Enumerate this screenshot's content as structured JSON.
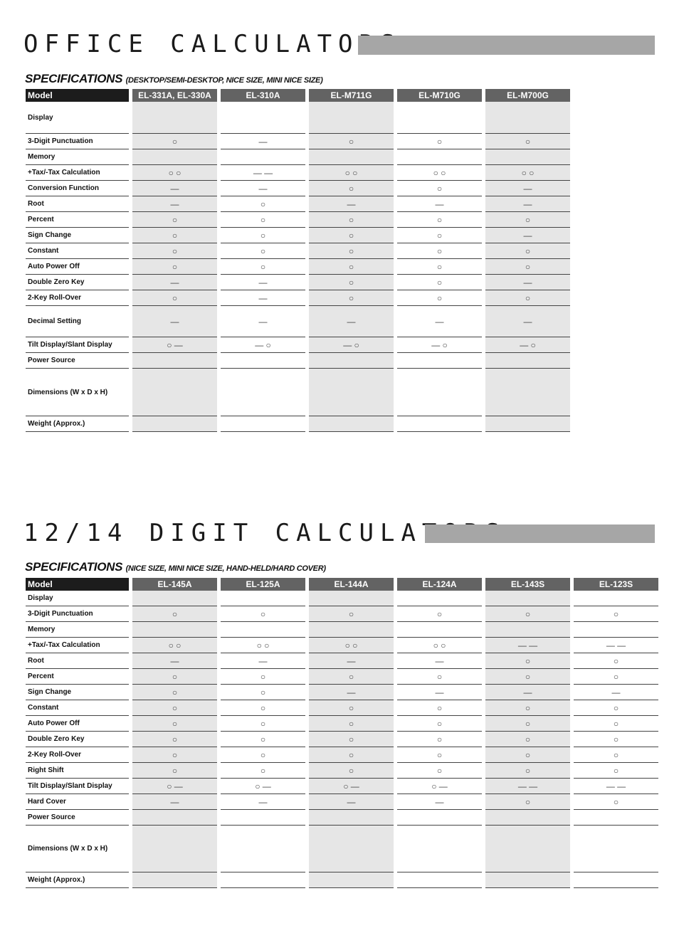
{
  "sections": [
    {
      "title": "OFFICE CALCULATORS",
      "spec": "SPECIFICATIONS",
      "spec_sub": "(DESKTOP/SEMI-DESKTOP, NICE SIZE, MINI NICE SIZE)",
      "header": "Model",
      "models": [
        "EL-331A, EL-330A",
        "EL-310A",
        "EL-M711G",
        "EL-M710G",
        "EL-M700G"
      ],
      "rows": [
        {
          "label": "Display",
          "values": [
            "",
            "",
            "",
            "",
            ""
          ]
        },
        {
          "label": "3-Digit Punctuation",
          "values": [
            "○",
            "—",
            "○",
            "○",
            "○"
          ]
        },
        {
          "label": "Memory",
          "values": [
            "",
            "",
            "",
            "",
            ""
          ]
        },
        {
          "label": "+Tax/-Tax Calculation",
          "values": [
            "○ ○",
            "— —",
            "○ ○",
            "○ ○",
            "○ ○"
          ]
        },
        {
          "label": "Conversion Function",
          "values": [
            "—",
            "—",
            "○",
            "○",
            "—"
          ]
        },
        {
          "label": "Root",
          "values": [
            "—",
            "○",
            "—",
            "—",
            "—"
          ]
        },
        {
          "label": "Percent",
          "values": [
            "○",
            "○",
            "○",
            "○",
            "○"
          ]
        },
        {
          "label": "Sign Change",
          "values": [
            "○",
            "○",
            "○",
            "○",
            "—"
          ]
        },
        {
          "label": "Constant",
          "values": [
            "○",
            "○",
            "○",
            "○",
            "○"
          ]
        },
        {
          "label": "Auto Power Off",
          "values": [
            "○",
            "○",
            "○",
            "○",
            "○"
          ]
        },
        {
          "label": "Double Zero Key",
          "values": [
            "—",
            "—",
            "○",
            "○",
            "—"
          ]
        },
        {
          "label": "2-Key Roll-Over",
          "values": [
            "○",
            "—",
            "○",
            "○",
            "○"
          ]
        },
        {
          "label": "Decimal Setting",
          "values": [
            "—",
            "—",
            "—",
            "—",
            "—"
          ]
        },
        {
          "label": "Tilt Display/Slant Display",
          "values": [
            "○ —",
            "— ○",
            "— ○",
            "— ○",
            "— ○"
          ]
        },
        {
          "label": "Power Source",
          "values": [
            "",
            "",
            "",
            "",
            ""
          ]
        },
        {
          "label": "Dimensions (W x D x H)",
          "values": [
            "",
            "",
            "",
            "",
            ""
          ]
        },
        {
          "label": "Weight (Approx.)",
          "values": [
            "",
            "",
            "",
            "",
            ""
          ]
        }
      ]
    },
    {
      "title": "12/14 DIGIT CALCULATORS",
      "spec": "SPECIFICATIONS",
      "spec_sub": "(NICE SIZE, MINI NICE SIZE, HAND-HELD/HARD COVER)",
      "header": "Model",
      "models": [
        "EL-145A",
        "EL-125A",
        "EL-144A",
        "EL-124A",
        "EL-143S",
        "EL-123S"
      ],
      "rows": [
        {
          "label": "Display",
          "values": [
            "",
            "",
            "",
            "",
            "",
            ""
          ]
        },
        {
          "label": "3-Digit Punctuation",
          "values": [
            "○",
            "○",
            "○",
            "○",
            "○",
            "○"
          ]
        },
        {
          "label": "Memory",
          "values": [
            "",
            "",
            "",
            "",
            "",
            ""
          ]
        },
        {
          "label": "+Tax/-Tax Calculation",
          "values": [
            "○ ○",
            "○ ○",
            "○ ○",
            "○ ○",
            "— —",
            "— —"
          ]
        },
        {
          "label": "Root",
          "values": [
            "—",
            "—",
            "—",
            "—",
            "○",
            "○"
          ]
        },
        {
          "label": "Percent",
          "values": [
            "○",
            "○",
            "○",
            "○",
            "○",
            "○"
          ]
        },
        {
          "label": "Sign Change",
          "values": [
            "○",
            "○",
            "—",
            "—",
            "—",
            "—"
          ]
        },
        {
          "label": "Constant",
          "values": [
            "○",
            "○",
            "○",
            "○",
            "○",
            "○"
          ]
        },
        {
          "label": "Auto Power Off",
          "values": [
            "○",
            "○",
            "○",
            "○",
            "○",
            "○"
          ]
        },
        {
          "label": "Double Zero Key",
          "values": [
            "○",
            "○",
            "○",
            "○",
            "○",
            "○"
          ]
        },
        {
          "label": "2-Key Roll-Over",
          "values": [
            "○",
            "○",
            "○",
            "○",
            "○",
            "○"
          ]
        },
        {
          "label": "Right Shift",
          "values": [
            "○",
            "○",
            "○",
            "○",
            "○",
            "○"
          ]
        },
        {
          "label": "Tilt Display/Slant Display",
          "values": [
            "○ —",
            "○ —",
            "○ —",
            "○ —",
            "— —",
            "— —"
          ]
        },
        {
          "label": "Hard Cover",
          "values": [
            "—",
            "—",
            "—",
            "—",
            "○",
            "○"
          ]
        },
        {
          "label": "Power Source",
          "values": [
            "",
            "",
            "",
            "",
            "",
            ""
          ]
        },
        {
          "label": "Dimensions (W x D x H)",
          "values": [
            "",
            "",
            "",
            "",
            "",
            ""
          ]
        },
        {
          "label": "Weight (Approx.)",
          "values": [
            "",
            "",
            "",
            "",
            "",
            ""
          ]
        }
      ]
    }
  ]
}
